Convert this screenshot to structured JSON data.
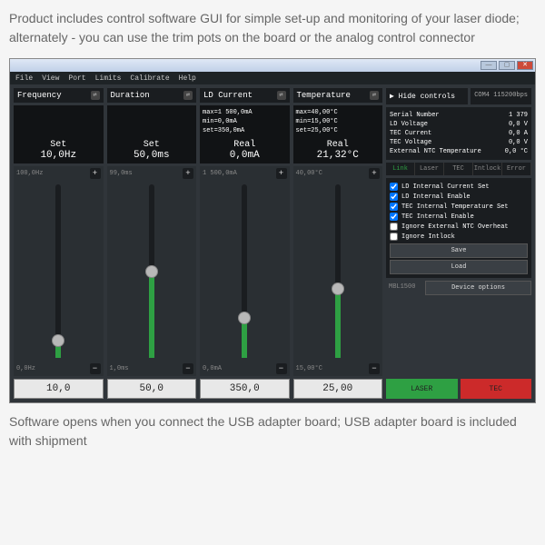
{
  "intro_text": "Product includes control software GUI for simple set-up and monitoring of your laser diode; alternately - you can use the trim pots on the board or the analog control connector",
  "outro_text": "Software opens when you connect the USB adapter board; USB adapter board is included with shipment",
  "menu": [
    "File",
    "View",
    "Port",
    "Limits",
    "Calibrate",
    "Help"
  ],
  "hide_controls": "▶ Hide controls",
  "com_label": "COM4  115200bps",
  "channels": [
    {
      "title": "Frequency",
      "info": [],
      "set_label": "Set",
      "set_value": "10,0Hz",
      "slider_max": "100,0Hz",
      "slider_min": "0,0Hz",
      "fill_pct": 10,
      "input": "10,0"
    },
    {
      "title": "Duration",
      "info": [],
      "set_label": "Set",
      "set_value": "50,0ms",
      "slider_max": "99,0ms",
      "slider_min": "1,0ms",
      "fill_pct": 50,
      "input": "50,0"
    },
    {
      "title": "LD Current",
      "info": [
        "max=1 500,0mA",
        "min=0,0mA",
        "set=350,0mA"
      ],
      "set_label": "Real",
      "set_value": "0,0mA",
      "slider_max": "1 500,0mA",
      "slider_min": "0,0mA",
      "fill_pct": 23,
      "input": "350,0"
    },
    {
      "title": "Temperature",
      "info": [
        "max=40,00°C",
        "min=15,00°C",
        "set=25,00°C"
      ],
      "set_label": "Real",
      "set_value": "21,32°C",
      "slider_max": "40,00°C",
      "slider_min": "15,00°C",
      "fill_pct": 40,
      "input": "25,00"
    }
  ],
  "status": {
    "Serial Number": "1 379",
    "LD Voltage": "0,0  V",
    "TEC Current": "0,0  A",
    "TEC Voltage": "0,0  V",
    "External NTC Temperature": "0,0 °C"
  },
  "tabs": [
    "Link",
    "Laser",
    "TEC",
    "Intlock",
    "Error"
  ],
  "active_tab": 0,
  "checks": [
    {
      "label": "LD Internal Current Set",
      "checked": true
    },
    {
      "label": "LD Internal Enable",
      "checked": true
    },
    {
      "label": "TEC Internal Temperature Set",
      "checked": true
    },
    {
      "label": "TEC Internal Enable",
      "checked": true
    },
    {
      "label": "Ignore External NTC Overheat",
      "checked": false
    },
    {
      "label": "Ignore Intlock",
      "checked": false
    }
  ],
  "save_label": "Save",
  "load_label": "Load",
  "device_model": "MBL1500",
  "device_options_label": "Device options",
  "laser_on": "LASER",
  "tec_on": "TEC"
}
